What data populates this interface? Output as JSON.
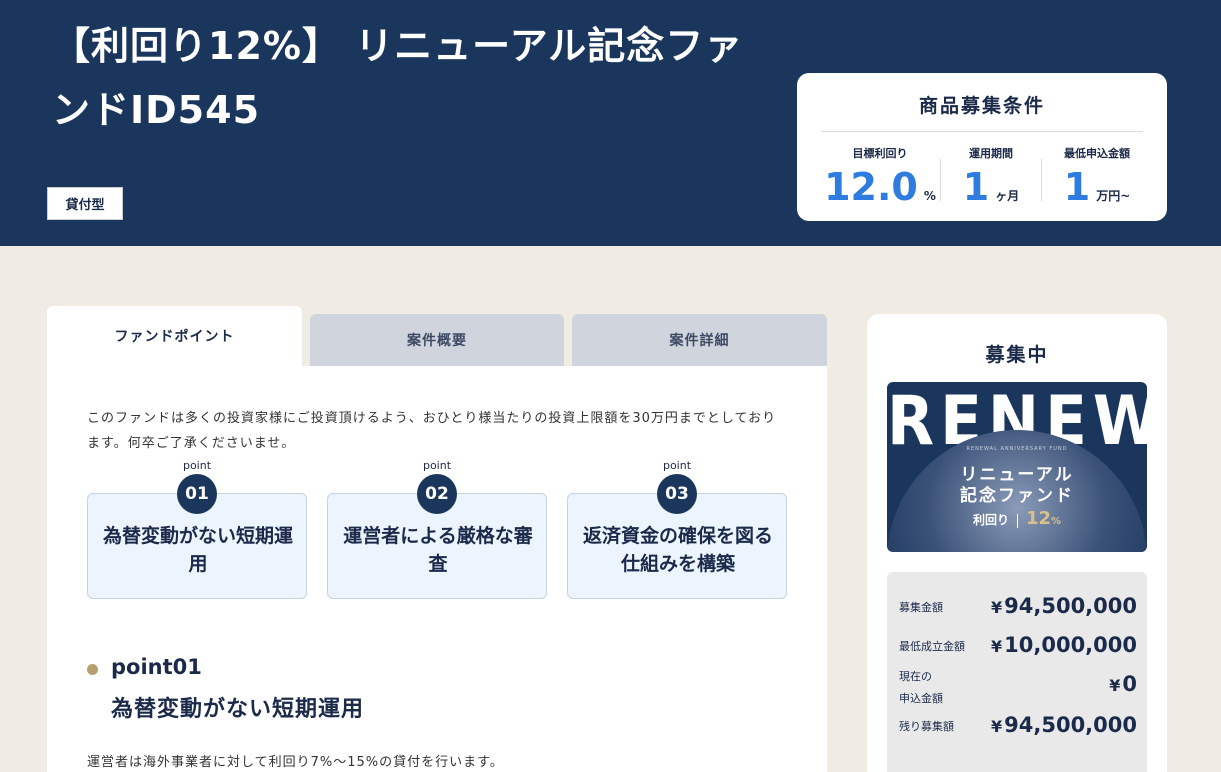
{
  "hero": {
    "title": "【利回り12%】 リニューアル記念ファンドID545",
    "badge": "貸付型"
  },
  "conditions": {
    "title": "商品募集条件",
    "items": [
      {
        "label": "目標利回り",
        "value": "12.0",
        "unit": "%"
      },
      {
        "label": "運用期間",
        "value": "1",
        "unit": "ヶ月"
      },
      {
        "label": "最低申込金額",
        "value": "1",
        "unit": "万円~"
      }
    ]
  },
  "tabs": [
    {
      "label": "ファンドポイント",
      "active": true
    },
    {
      "label": "案件概要",
      "active": false
    },
    {
      "label": "案件詳細",
      "active": false
    }
  ],
  "panel": {
    "intro": "このファンドは多くの投資家様にご投資頂けるよう、おひとり様当たりの投資上限額を30万円までとしております。何卒ご了承くださいませ。",
    "point_label": "point",
    "points": [
      {
        "num": "01",
        "text": "為替変動がない短期運用"
      },
      {
        "num": "02",
        "text": "運営者による厳格な審査"
      },
      {
        "num": "03",
        "text": "返済資金の確保を図る仕組みを構築"
      }
    ],
    "section": {
      "sub": "point01",
      "title": "為替変動がない短期運用",
      "body": "運営者は海外事業者に対して利回り7%～15%の貸付を行います。"
    }
  },
  "sidebar": {
    "title": "募集中",
    "banner": {
      "big": "RENEWAL",
      "tiny": "RENEWAL ANNIVERSARY FUND",
      "line1": "リニューアル",
      "line2": "記念ファンド",
      "rate_label": "利回り",
      "rate_value": "12",
      "rate_unit": "%"
    },
    "stats": [
      {
        "label": "募集金額",
        "currency": "¥",
        "amount": "94,500,000"
      },
      {
        "label": "最低成立金額",
        "currency": "¥",
        "amount": "10,000,000"
      },
      {
        "label": "現在の\n申込金額",
        "currency": "¥",
        "amount": "0"
      },
      {
        "label": "残り募集額",
        "currency": "¥",
        "amount": "94,500,000"
      }
    ]
  },
  "colors": {
    "navy": "#1b365d",
    "accent_blue": "#2f7ce0",
    "gold": "#b8a06e",
    "page_bg": "#f0ece3"
  }
}
